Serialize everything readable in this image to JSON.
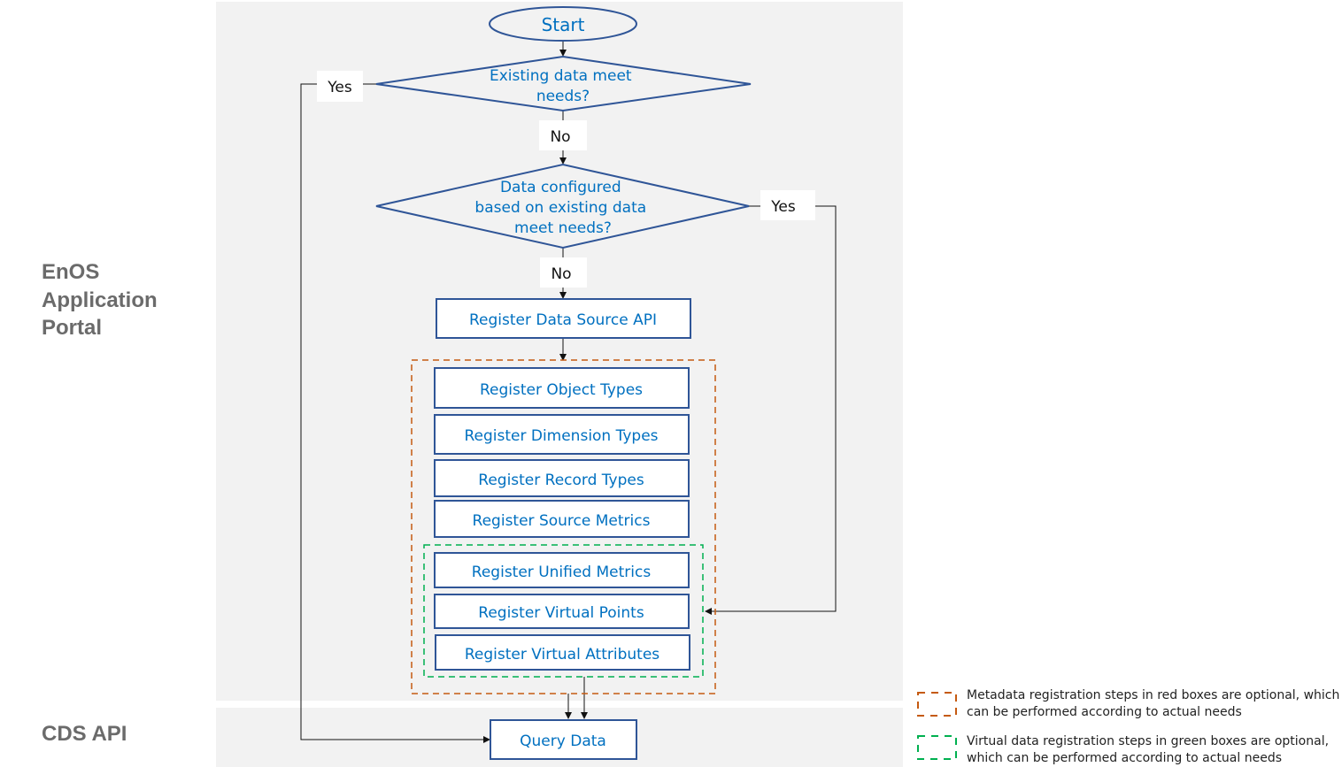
{
  "lanes": {
    "portal": [
      "EnOS",
      "Application",
      "Portal"
    ],
    "api": "CDS API"
  },
  "nodes": {
    "start": "Start",
    "decision1": [
      "Existing data meet",
      "needs?"
    ],
    "decision2": [
      "Data configured",
      "based on existing data",
      "meet needs?"
    ],
    "register_data_source_api": "Register Data Source API",
    "metadata_steps": [
      "Register Object Types",
      "Register Dimension Types",
      "Register Record Types",
      "Register Source Metrics"
    ],
    "virtual_steps": [
      "Register Unified Metrics",
      "Register Virtual Points",
      "Register Virtual Attributes"
    ],
    "query_data": "Query Data"
  },
  "edges": {
    "d1_yes": "Yes",
    "d1_no": "No",
    "d2_yes": "Yes",
    "d2_no": "No"
  },
  "legend": {
    "metadata": [
      "Metadata registration steps in red boxes are optional, which",
      "can be performed according to actual needs"
    ],
    "virtual": [
      "Virtual data registration steps in green boxes are optional,",
      "which can be performed according to actual needs"
    ]
  },
  "colors": {
    "lane_bg": "#f2f2f2",
    "node_border": "#2f5597",
    "node_text": "#0070c0",
    "metadata_group": "#c55a11",
    "virtual_group": "#00b050"
  }
}
